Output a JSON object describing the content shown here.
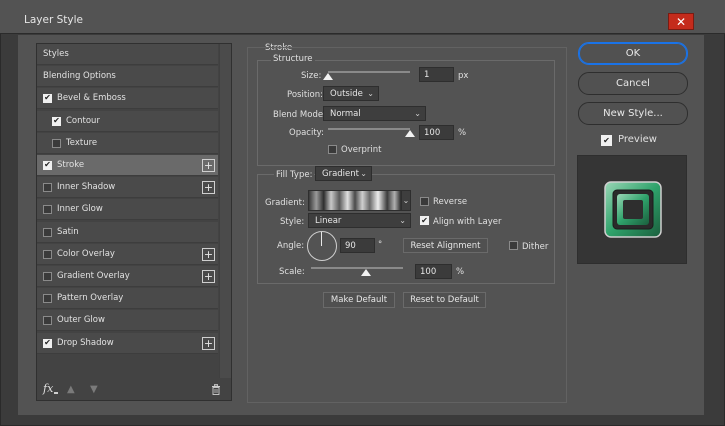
{
  "window": {
    "title": "Layer Style",
    "close_glyph": "✕"
  },
  "sidebar": {
    "items": [
      {
        "label": "Styles",
        "checkbox": false,
        "checked": false,
        "plus": false
      },
      {
        "label": "Blending Options",
        "checkbox": false,
        "checked": false,
        "plus": false
      },
      {
        "label": "Bevel & Emboss",
        "checkbox": true,
        "checked": true,
        "plus": false
      },
      {
        "label": "Contour",
        "checkbox": true,
        "checked": true,
        "plus": false,
        "indent": true
      },
      {
        "label": "Texture",
        "checkbox": true,
        "checked": false,
        "plus": false,
        "indent": true
      },
      {
        "label": "Stroke",
        "checkbox": true,
        "checked": true,
        "plus": true,
        "selected": true
      },
      {
        "label": "Inner Shadow",
        "checkbox": true,
        "checked": false,
        "plus": true
      },
      {
        "label": "Inner Glow",
        "checkbox": true,
        "checked": false,
        "plus": false
      },
      {
        "label": "Satin",
        "checkbox": true,
        "checked": false,
        "plus": false
      },
      {
        "label": "Color Overlay",
        "checkbox": true,
        "checked": false,
        "plus": true
      },
      {
        "label": "Gradient Overlay",
        "checkbox": true,
        "checked": false,
        "plus": true
      },
      {
        "label": "Pattern Overlay",
        "checkbox": true,
        "checked": false,
        "plus": false
      },
      {
        "label": "Outer Glow",
        "checkbox": true,
        "checked": false,
        "plus": false
      },
      {
        "label": "Drop Shadow",
        "checkbox": true,
        "checked": true,
        "plus": true
      }
    ],
    "fx_label": "fx",
    "icons": [
      "fx-icon",
      "arrow-up-icon",
      "arrow-down-icon",
      "trash-icon"
    ]
  },
  "stroke": {
    "section_title": "Stroke",
    "structure_title": "Structure",
    "size_label": "Size:",
    "size_value": "1",
    "size_unit": "px",
    "position_label": "Position:",
    "position_value": "Outside",
    "blend_mode_label": "Blend Mode:",
    "blend_mode_value": "Normal",
    "opacity_label": "Opacity:",
    "opacity_value": "100",
    "opacity_unit": "%",
    "opacity_level": 1.0,
    "size_level": 0.0,
    "overprint_label": "Overprint",
    "overprint_checked": false,
    "fill_type_label": "Fill Type:",
    "fill_type_value": "Gradient",
    "gradient_label": "Gradient:",
    "reverse_label": "Reverse",
    "reverse_checked": false,
    "style_label": "Style:",
    "style_value": "Linear",
    "align_label": "Align with Layer",
    "align_checked": true,
    "angle_label": "Angle:",
    "angle_value": "90",
    "angle_unit": "°",
    "reset_alignment_label": "Reset Alignment",
    "dither_label": "Dither",
    "dither_checked": false,
    "scale_label": "Scale:",
    "scale_value": "100",
    "scale_unit": "%",
    "scale_level": 0.6,
    "make_default_label": "Make Default",
    "reset_default_label": "Reset to Default"
  },
  "actions": {
    "ok_label": "OK",
    "cancel_label": "Cancel",
    "new_style_label": "New Style...",
    "preview_label": "Preview",
    "preview_checked": true
  },
  "colors": {
    "accent": "#1a73e8",
    "preview_green": "#2fa36b"
  }
}
